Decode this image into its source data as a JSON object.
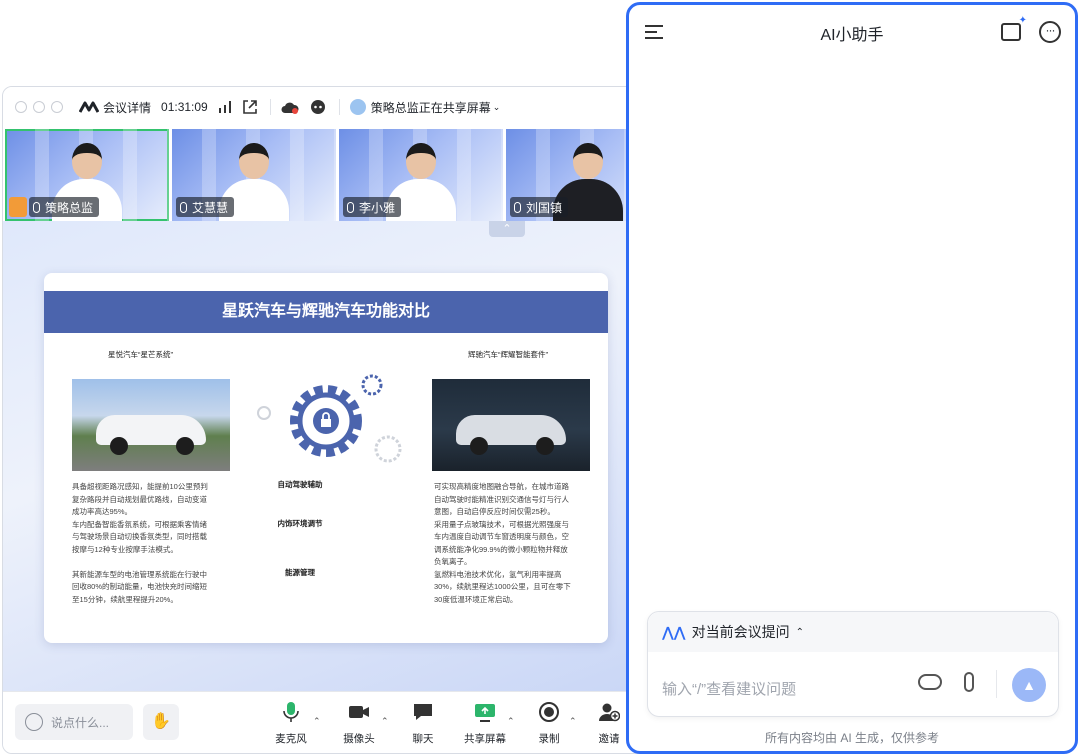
{
  "meeting": {
    "title_label": "会议详情",
    "timer": "01:31:09",
    "sharing_status": "策略总监正在共享屏幕",
    "participants": [
      {
        "name": "策略总监",
        "active": true
      },
      {
        "name": "艾慧慧",
        "active": false
      },
      {
        "name": "李小雅",
        "active": false
      },
      {
        "name": "刘国镇",
        "active": false
      }
    ],
    "slide": {
      "title": "星跃汽车与辉驰汽车功能对比",
      "left_subtitle": "星悦汽车“星芒系统”",
      "right_subtitle": "辉驰汽车“辉耀智能套件”",
      "features": [
        "自动驾驶辅助",
        "内饰环境调节",
        "能源管理"
      ],
      "left_text": "具备超视距路况感知，能提前10公里预判\n复杂路段并自动规划最优路线，自动变道\n成功率高达95%。\n车内配备智能香氛系统，可根据乘客情绪\n与驾驶场景自动切换香氛类型，同时搭载\n按摩与12种专业按摩手法模式。\n\n其新能源车型的电池管理系统能在行驶中\n回收80%的制动能量，电池快充时间缩短\n至15分钟，续航里程提升20%。",
      "right_text": "可实现高精度地图融合导航，在城市道路\n自动驾驶时能精准识别交通信号灯与行人\n意图，自动启停反应时间仅需25秒。\n采用量子点玻璃技术，可根据光照强度与\n车内温度自动调节车窗透明度与颜色，空\n调系统能净化99.9%的微小颗粒物并释放\n负氧离子。\n氢燃料电池技术优化，氢气利用率提高\n30%，续航里程达1000公里，且可在零下\n30度低温环境正常启动。"
    },
    "input_placeholder": "说点什么...",
    "controls": [
      {
        "label": "麦克风"
      },
      {
        "label": "摄像头"
      },
      {
        "label": "聊天"
      },
      {
        "label": "共享屏幕"
      },
      {
        "label": "录制"
      },
      {
        "label": "邀请"
      }
    ]
  },
  "assistant": {
    "title": "AI小助手",
    "context_label": "对当前会议提问",
    "input_placeholder": "输入“/”查看建议问题",
    "footer": "所有内容均由 AI 生成，仅供参考"
  }
}
